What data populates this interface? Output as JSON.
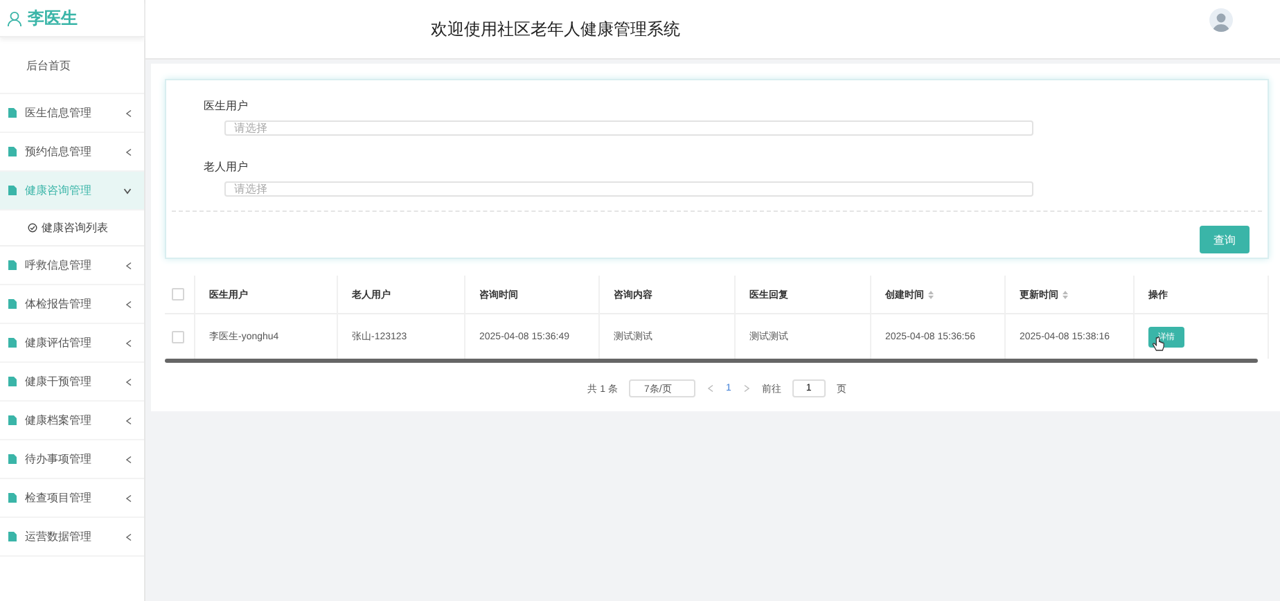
{
  "sidebar": {
    "user_name": "李医生",
    "items": [
      {
        "label": "后台首页",
        "kind": "link",
        "selected": false
      },
      {
        "label": "医生信息管理",
        "kind": "menu",
        "selected": false,
        "expanded": false
      },
      {
        "label": "预约信息管理",
        "kind": "menu",
        "selected": false,
        "expanded": false
      },
      {
        "label": "健康咨询管理",
        "kind": "menu",
        "selected": true,
        "expanded": true,
        "children": [
          {
            "label": "健康咨询列表",
            "selected": false
          }
        ]
      },
      {
        "label": "呼救信息管理",
        "kind": "menu",
        "selected": false,
        "expanded": false
      },
      {
        "label": "体检报告管理",
        "kind": "menu",
        "selected": false,
        "expanded": false
      },
      {
        "label": "健康评估管理",
        "kind": "menu",
        "selected": false,
        "expanded": false
      },
      {
        "label": "健康干预管理",
        "kind": "menu",
        "selected": false,
        "expanded": false
      },
      {
        "label": "健康档案管理",
        "kind": "menu",
        "selected": false,
        "expanded": false
      },
      {
        "label": "待办事项管理",
        "kind": "menu",
        "selected": false,
        "expanded": false
      },
      {
        "label": "检查项目管理",
        "kind": "menu",
        "selected": false,
        "expanded": false
      },
      {
        "label": "运营数据管理",
        "kind": "menu",
        "selected": false,
        "expanded": false
      }
    ]
  },
  "header": {
    "title": "欢迎使用社区老年人健康管理系统"
  },
  "search_form": {
    "fields": [
      {
        "label": "医生用户",
        "placeholder": "请选择"
      },
      {
        "label": "老人用户",
        "placeholder": "请选择"
      }
    ],
    "button": "查询"
  },
  "table": {
    "select_all_checked": false,
    "columns": [
      {
        "label": "医生用户",
        "sortable": false
      },
      {
        "label": "老人用户",
        "sortable": false
      },
      {
        "label": "咨询时间",
        "sortable": false
      },
      {
        "label": "咨询内容",
        "sortable": false
      },
      {
        "label": "医生回复",
        "sortable": false
      },
      {
        "label": "创建时间",
        "sortable": true
      },
      {
        "label": "更新时间",
        "sortable": true
      },
      {
        "label": "操作",
        "sortable": false
      }
    ],
    "rows": [
      {
        "checked": false,
        "cells": [
          "李医生-yonghu4",
          "张山-123123",
          "2025-04-08 15:36:49",
          "测试测试",
          "测试测试",
          "2025-04-08 15:36:56",
          "2025-04-08 15:38:16"
        ],
        "action": "详情"
      }
    ]
  },
  "pagination": {
    "total": "共 1 条",
    "page_size": "7条/页",
    "pages": [
      {
        "label": "1",
        "selected": true
      }
    ],
    "goto_label": "前往",
    "goto_value": "1",
    "goto_suffix": "页"
  }
}
